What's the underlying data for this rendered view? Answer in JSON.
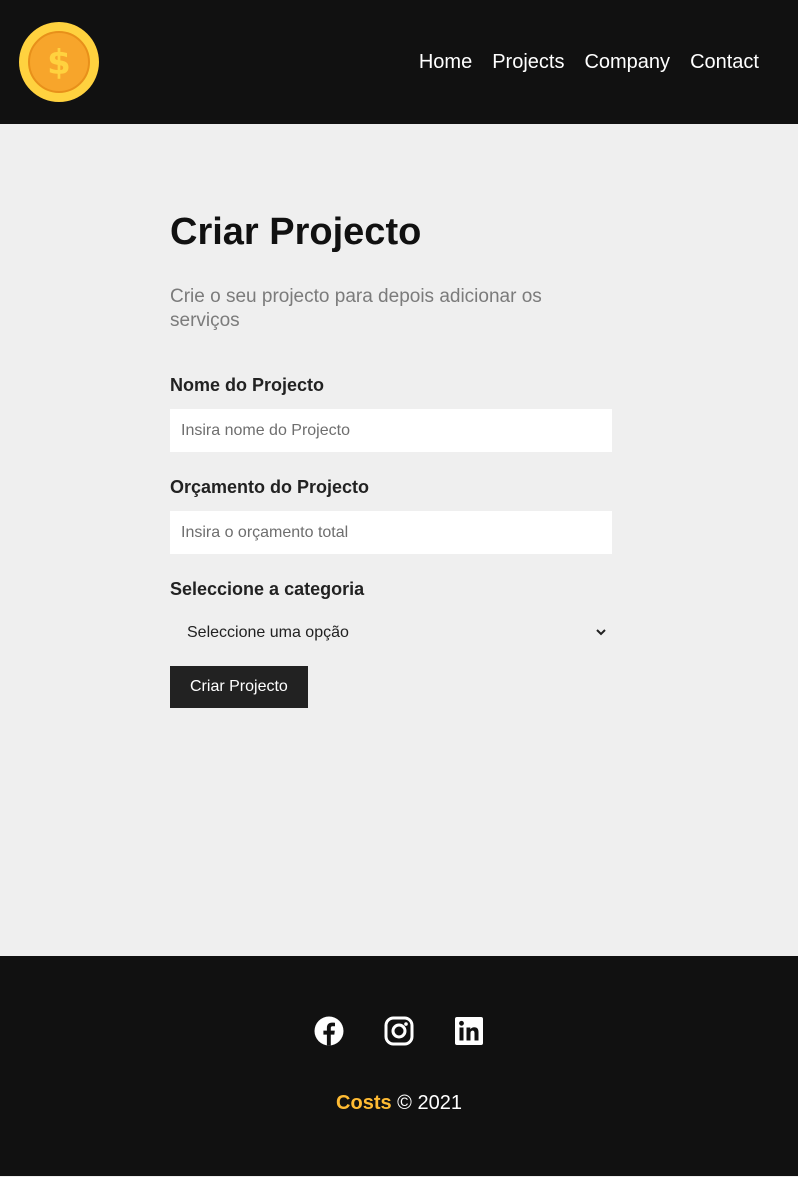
{
  "colors": {
    "nav_bg": "#111111",
    "page_bg": "#efefef",
    "accent": "#ffbb33",
    "button_bg": "#222222"
  },
  "navbar": {
    "logo_icon": "gold-coin-dollar-icon",
    "links": [
      {
        "label": "Home"
      },
      {
        "label": "Projects"
      },
      {
        "label": "Company"
      },
      {
        "label": "Contact"
      }
    ]
  },
  "main": {
    "title": "Criar Projecto",
    "subtitle": "Crie o seu projecto para depois adicionar os serviços",
    "form": {
      "name_label": "Nome do Projecto",
      "name_placeholder": "Insira nome do Projecto",
      "budget_label": "Orçamento do Projecto",
      "budget_placeholder": "Insira o orçamento total",
      "category_label": "Seleccione a categoria",
      "category_selected": "Seleccione uma opção",
      "submit_label": "Criar Projecto"
    }
  },
  "footer": {
    "social_icons": [
      "facebook-icon",
      "instagram-icon",
      "linkedin-icon"
    ],
    "brand": "Costs",
    "copyright": "© 2021"
  }
}
